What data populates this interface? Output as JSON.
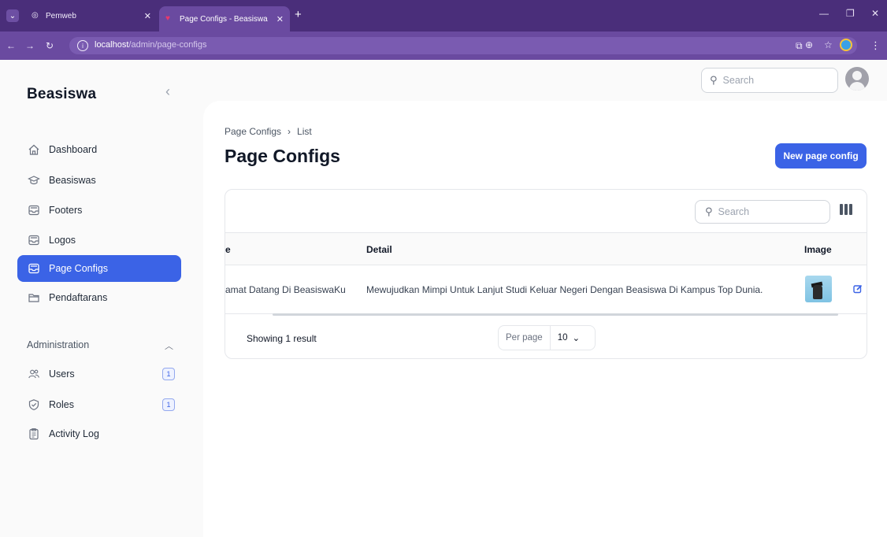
{
  "browser": {
    "tabs": [
      {
        "title": "Pemweb",
        "active": false
      },
      {
        "title": "Page Configs - Beasiswa",
        "active": true
      }
    ],
    "url_host": "localhost",
    "url_path": "/admin/page-configs"
  },
  "app": {
    "brand": "Beasiswa",
    "search_placeholder": "Search"
  },
  "sidebar": {
    "items": [
      {
        "label": "Dashboard",
        "icon": "home-icon",
        "active": false
      },
      {
        "label": "Beasiswas",
        "icon": "graduation-cap-icon",
        "active": false
      },
      {
        "label": "Footers",
        "icon": "inbox-icon",
        "active": false
      },
      {
        "label": "Logos",
        "icon": "inbox-icon",
        "active": false
      },
      {
        "label": "Page Configs",
        "icon": "inbox-icon",
        "active": true
      },
      {
        "label": "Pendaftarans",
        "icon": "folder-icon",
        "active": false
      }
    ],
    "group_label": "Administration",
    "admin_items": [
      {
        "label": "Users",
        "icon": "users-icon",
        "badge": "1"
      },
      {
        "label": "Roles",
        "icon": "shield-check-icon",
        "badge": "1"
      },
      {
        "label": "Activity Log",
        "icon": "clipboard-icon",
        "badge": null
      }
    ]
  },
  "main": {
    "breadcrumb": [
      "Page Configs",
      "List"
    ],
    "title": "Page Configs",
    "new_button": "New page config",
    "table": {
      "search_placeholder": "Search",
      "columns": [
        "e",
        "Detail",
        "Image"
      ],
      "rows": [
        {
          "title": "amat Datang Di BeasiswaKu",
          "detail": "Mewujudkan Mimpi Untuk Lanjut Studi Keluar Negeri Dengan Beasiswa Di Kampus Top Dunia."
        }
      ],
      "summary": "Showing 1 result",
      "per_page_label": "Per page",
      "per_page_value": "10"
    }
  },
  "colors": {
    "primary": "#3b63e6",
    "browser_frame": "#4a2e7a",
    "toolbar": "#6a4aa0"
  }
}
